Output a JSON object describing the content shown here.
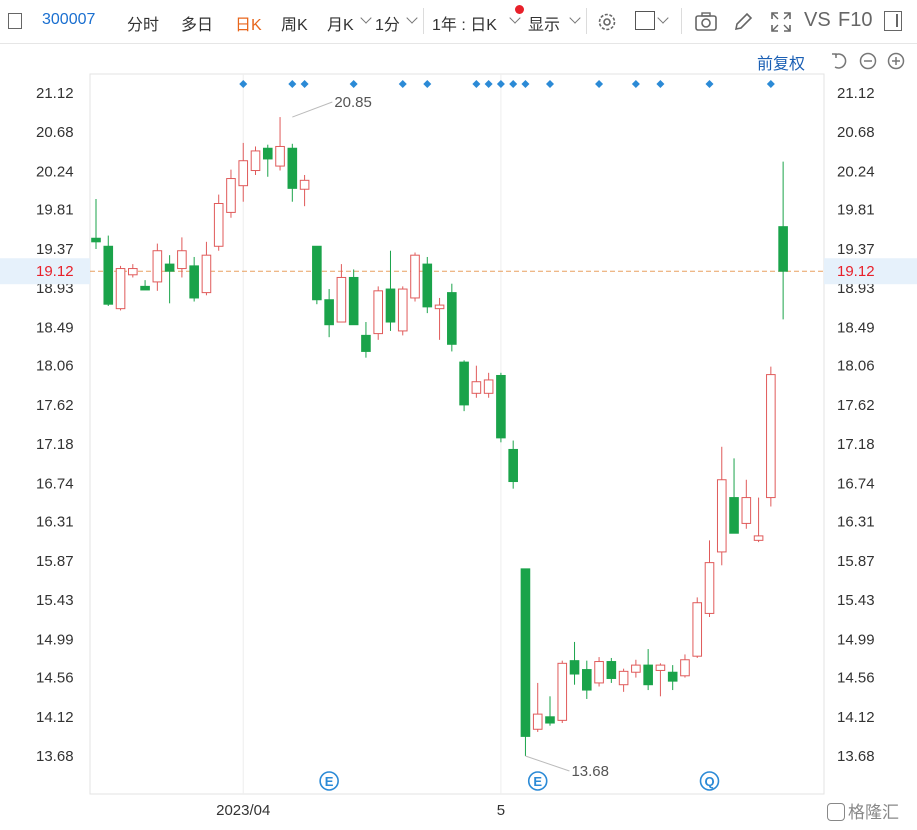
{
  "toolbar": {
    "stock_code": "300007",
    "tabs": [
      {
        "label": "分时",
        "active": false
      },
      {
        "label": "多日",
        "active": false
      },
      {
        "label": "日K",
        "active": true
      },
      {
        "label": "周K",
        "active": false
      },
      {
        "label": "月K",
        "active": false
      },
      {
        "label": "1分",
        "active": false
      }
    ],
    "range_label": "1年 : 日K",
    "display_label": "显示",
    "vs_label": "VS",
    "f10_label": "F10",
    "icons": [
      "sidebar-toggle-icon",
      "settings-gear-icon",
      "square-color-icon",
      "camera-icon",
      "pencil-icon",
      "fullscreen-icon",
      "panel-icon"
    ]
  },
  "subbar": {
    "adjust_label": "前复权",
    "icons": [
      "undo-icon",
      "zoom-out-icon",
      "zoom-in-icon"
    ]
  },
  "watermark": "格隆汇",
  "colors": {
    "up": "#e05a5a",
    "down": "#1aa34a",
    "price_line": "#e8a060",
    "accent": "#1a6fd0",
    "active_tab": "#e8661c",
    "current_price": "#e8202a"
  },
  "chart_data": {
    "type": "candlestick",
    "symbol": "300007",
    "period": "日K",
    "adjustment": "前复权",
    "y_ticks": [
      21.12,
      20.68,
      20.24,
      19.81,
      19.37,
      18.93,
      18.49,
      18.06,
      17.62,
      17.18,
      16.74,
      16.31,
      15.87,
      15.43,
      14.99,
      14.56,
      14.12,
      13.68
    ],
    "ylim": [
      13.4,
      21.4
    ],
    "x_labels": [
      {
        "label": "2023/04",
        "index": 12
      },
      {
        "label": "5",
        "index": 33
      }
    ],
    "current_price": 19.12,
    "annotations": [
      {
        "text": "20.85",
        "index": 16,
        "value": 20.85
      },
      {
        "text": "13.68",
        "index": 35,
        "value": 13.68
      }
    ],
    "event_markers": [
      {
        "symbol": "E",
        "index": 19
      },
      {
        "symbol": "E",
        "index": 36
      },
      {
        "symbol": "Q",
        "index": 50
      }
    ],
    "dividend_markers": [
      12,
      16,
      17,
      21,
      25,
      27,
      31,
      32,
      33,
      34,
      35,
      37,
      41,
      44,
      46,
      50,
      55
    ],
    "candles": [
      {
        "o": 19.49,
        "h": 19.93,
        "l": 19.37,
        "c": 19.45
      },
      {
        "o": 19.4,
        "h": 19.52,
        "l": 18.73,
        "c": 18.75
      },
      {
        "o": 18.7,
        "h": 19.18,
        "l": 18.68,
        "c": 19.15
      },
      {
        "o": 19.08,
        "h": 19.2,
        "l": 19.05,
        "c": 19.15
      },
      {
        "o": 18.95,
        "h": 19.02,
        "l": 18.92,
        "c": 18.91
      },
      {
        "o": 19.0,
        "h": 19.43,
        "l": 18.9,
        "c": 19.35
      },
      {
        "o": 19.2,
        "h": 19.3,
        "l": 18.76,
        "c": 19.12
      },
      {
        "o": 19.15,
        "h": 19.5,
        "l": 19.05,
        "c": 19.35
      },
      {
        "o": 19.18,
        "h": 19.28,
        "l": 18.78,
        "c": 18.82
      },
      {
        "o": 18.88,
        "h": 19.45,
        "l": 18.85,
        "c": 19.3
      },
      {
        "o": 19.4,
        "h": 19.98,
        "l": 19.35,
        "c": 19.88
      },
      {
        "o": 19.78,
        "h": 20.26,
        "l": 19.72,
        "c": 20.16
      },
      {
        "o": 20.08,
        "h": 20.56,
        "l": 19.9,
        "c": 20.36
      },
      {
        "o": 20.25,
        "h": 20.52,
        "l": 20.2,
        "c": 20.47
      },
      {
        "o": 20.5,
        "h": 20.54,
        "l": 20.18,
        "c": 20.38
      },
      {
        "o": 20.3,
        "h": 20.85,
        "l": 20.25,
        "c": 20.52
      },
      {
        "o": 20.5,
        "h": 20.55,
        "l": 19.9,
        "c": 20.05
      },
      {
        "o": 20.04,
        "h": 20.2,
        "l": 19.85,
        "c": 20.14
      },
      {
        "o": 19.4,
        "h": 19.4,
        "l": 18.75,
        "c": 18.8
      },
      {
        "o": 18.8,
        "h": 18.92,
        "l": 18.38,
        "c": 18.52
      },
      {
        "o": 18.55,
        "h": 19.2,
        "l": 18.55,
        "c": 19.05
      },
      {
        "o": 19.05,
        "h": 19.14,
        "l": 18.52,
        "c": 18.52
      },
      {
        "o": 18.4,
        "h": 18.55,
        "l": 18.15,
        "c": 18.22
      },
      {
        "o": 18.42,
        "h": 18.95,
        "l": 18.35,
        "c": 18.9
      },
      {
        "o": 18.92,
        "h": 19.35,
        "l": 18.45,
        "c": 18.55
      },
      {
        "o": 18.45,
        "h": 18.95,
        "l": 18.4,
        "c": 18.92
      },
      {
        "o": 18.82,
        "h": 19.33,
        "l": 18.78,
        "c": 19.3
      },
      {
        "o": 19.2,
        "h": 19.28,
        "l": 18.65,
        "c": 18.72
      },
      {
        "o": 18.7,
        "h": 18.82,
        "l": 18.35,
        "c": 18.74
      },
      {
        "o": 18.88,
        "h": 18.98,
        "l": 18.22,
        "c": 18.3
      },
      {
        "o": 18.1,
        "h": 18.12,
        "l": 17.55,
        "c": 17.62
      },
      {
        "o": 17.75,
        "h": 18.06,
        "l": 17.7,
        "c": 17.88
      },
      {
        "o": 17.75,
        "h": 17.98,
        "l": 17.7,
        "c": 17.9
      },
      {
        "o": 17.95,
        "h": 17.98,
        "l": 17.2,
        "c": 17.25
      },
      {
        "o": 17.12,
        "h": 17.22,
        "l": 16.68,
        "c": 16.76
      },
      {
        "o": 15.78,
        "h": 15.78,
        "l": 13.68,
        "c": 13.9
      },
      {
        "o": 13.98,
        "h": 14.5,
        "l": 13.95,
        "c": 14.15
      },
      {
        "o": 14.12,
        "h": 14.35,
        "l": 14.02,
        "c": 14.05
      },
      {
        "o": 14.08,
        "h": 14.75,
        "l": 14.05,
        "c": 14.72
      },
      {
        "o": 14.75,
        "h": 14.96,
        "l": 14.48,
        "c": 14.6
      },
      {
        "o": 14.65,
        "h": 14.75,
        "l": 14.32,
        "c": 14.42
      },
      {
        "o": 14.5,
        "h": 14.79,
        "l": 14.46,
        "c": 14.74
      },
      {
        "o": 14.74,
        "h": 14.78,
        "l": 14.5,
        "c": 14.55
      },
      {
        "o": 14.48,
        "h": 14.66,
        "l": 14.4,
        "c": 14.63
      },
      {
        "o": 14.62,
        "h": 14.76,
        "l": 14.56,
        "c": 14.7
      },
      {
        "o": 14.7,
        "h": 14.88,
        "l": 14.42,
        "c": 14.48
      },
      {
        "o": 14.64,
        "h": 14.72,
        "l": 14.35,
        "c": 14.7
      },
      {
        "o": 14.62,
        "h": 14.7,
        "l": 14.42,
        "c": 14.52
      },
      {
        "o": 14.58,
        "h": 14.82,
        "l": 14.56,
        "c": 14.76
      },
      {
        "o": 14.8,
        "h": 15.46,
        "l": 14.78,
        "c": 15.4
      },
      {
        "o": 15.28,
        "h": 16.1,
        "l": 15.24,
        "c": 15.85
      },
      {
        "o": 15.97,
        "h": 17.15,
        "l": 15.82,
        "c": 16.78
      },
      {
        "o": 16.58,
        "h": 17.02,
        "l": 16.18,
        "c": 16.18
      },
      {
        "o": 16.29,
        "h": 16.78,
        "l": 16.23,
        "c": 16.58
      },
      {
        "o": 16.1,
        "h": 16.58,
        "l": 16.08,
        "c": 16.15
      },
      {
        "o": 16.58,
        "h": 18.05,
        "l": 16.48,
        "c": 17.96
      },
      {
        "o": 19.62,
        "h": 20.35,
        "l": 18.58,
        "c": 19.12
      }
    ]
  }
}
